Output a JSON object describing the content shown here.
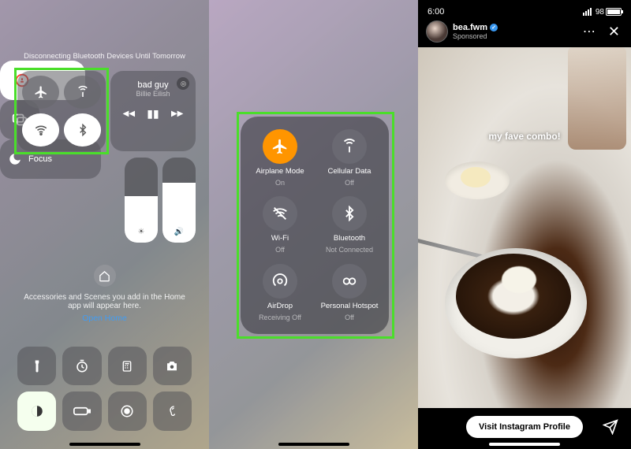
{
  "panel1": {
    "banner": "Disconnecting Bluetooth Devices Until Tomorrow",
    "media": {
      "title": "bad guy",
      "artist": "Billie Eilish"
    },
    "focus_label": "Focus",
    "home_text": "Accessories and Scenes you add in the Home app will appear here.",
    "home_link": "Open Home",
    "brightness_pct": 55,
    "volume_pct": 70
  },
  "panel2": {
    "items": [
      {
        "label": "Airplane Mode",
        "sub": "On"
      },
      {
        "label": "Cellular Data",
        "sub": "Off"
      },
      {
        "label": "Wi-Fi",
        "sub": "Off"
      },
      {
        "label": "Bluetooth",
        "sub": "Not Connected"
      },
      {
        "label": "AirDrop",
        "sub": "Receiving Off"
      },
      {
        "label": "Personal Hotspot",
        "sub": "Off"
      }
    ]
  },
  "panel3": {
    "time": "6:00",
    "battery": "98",
    "username": "bea.fwm",
    "sponsored": "Sponsored",
    "caption": "my fave combo!",
    "cta": "Visit Instagram Profile"
  },
  "icons": {
    "airplane": "airplane-icon",
    "antenna": "cellular-icon",
    "wifi": "wifi-icon",
    "bluetooth": "bluetooth-icon",
    "airdrop": "airdrop-icon",
    "hotspot": "hotspot-icon"
  }
}
